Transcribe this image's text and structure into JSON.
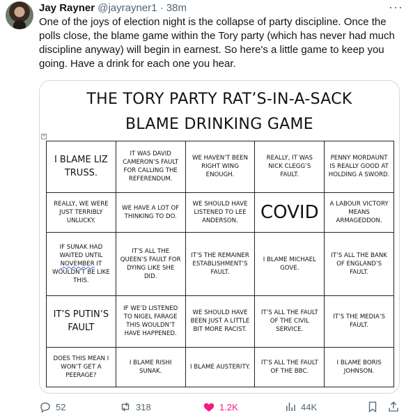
{
  "author": {
    "name": "Jay Rayner",
    "handle": "@jayrayner1",
    "separator": "·",
    "time": "38m"
  },
  "tweet": {
    "text": "One of the joys of election night is the collapse of party discipline. Once the polls close, the blame game within the Tory party (which has never had much discipline anyway) will begin in earnest. So here's a little game to keep you going. Have a drink for each one you hear."
  },
  "image": {
    "title_line1": "THE TORY PARTY RAT’S-IN-A-SACK",
    "title_line2": "BLAME DRINKING GAME",
    "grid": [
      [
        "I BLAME LIZ TRUSS.",
        "IT WAS DAVID CAMERON’S FAULT FOR CALLING THE REFERENDUM.",
        "WE HAVEN’T BEEN RIGHT WING ENOUGH.",
        "REALLY, IT WAS NICK CLEGG’S FAULT.",
        "PENNY MORDAUNT IS REALLY GOOD AT HOLDING A SWORD."
      ],
      [
        "REALLY, WE WERE JUST TERRIBLY UNLUCKY.",
        "WE HAVE A LOT OF THINKING TO DO.",
        "WE SHOULD HAVE LISTENED TO LEE ANDERSON.",
        "COVID",
        "A LABOUR VICTORY MEANS ARMAGEDDON."
      ],
      [
        "IF SUNAK HAD WAITED UNTIL NOVEMBER IT WOULDN’T BE LIKE THIS.",
        "IT’S ALL THE QUEEN’S FAULT FOR DYING LIKE SHE DID.",
        "IT’S THE REMAINER ESTABLISHMENT’S FAULT.",
        "I BLAME MICHAEL GOVE.",
        "IT’S ALL THE BANK OF ENGLAND’S FAULT."
      ],
      [
        "IT’S PUTIN’S FAULT",
        "IF WE’D LISTENED TO NIGEL FARAGE THIS WOULDN’T HAVE HAPPENED.",
        "WE SHOULD HAVE BEEN JUST A LITTLE BIT MORE RACIST.",
        "IT’S ALL THE FAULT OF THE CIVIL SERVICE.",
        "IT’S THE MEDIA’S FAULT."
      ],
      [
        "DOES THIS MEAN I WON’T GET A PEERAGE?",
        "I BLAME RISHI SUNAK.",
        "I BLAME AUSTERITY.",
        "IT’S ALL THE FAULT OF THE BBC.",
        "I BLAME BORIS JOHNSON."
      ]
    ]
  },
  "actions": {
    "replies": "52",
    "retweets": "318",
    "likes": "1.2K",
    "views": "44K"
  },
  "icons": {
    "more": "more-icon",
    "reply": "reply-icon",
    "retweet": "retweet-icon",
    "like": "heart-icon",
    "views": "views-icon",
    "bookmark": "bookmark-icon",
    "share": "share-icon",
    "table_anchor": "table-anchor-icon"
  },
  "colors": {
    "like_active": "#f91880",
    "secondary_text": "#536471"
  }
}
